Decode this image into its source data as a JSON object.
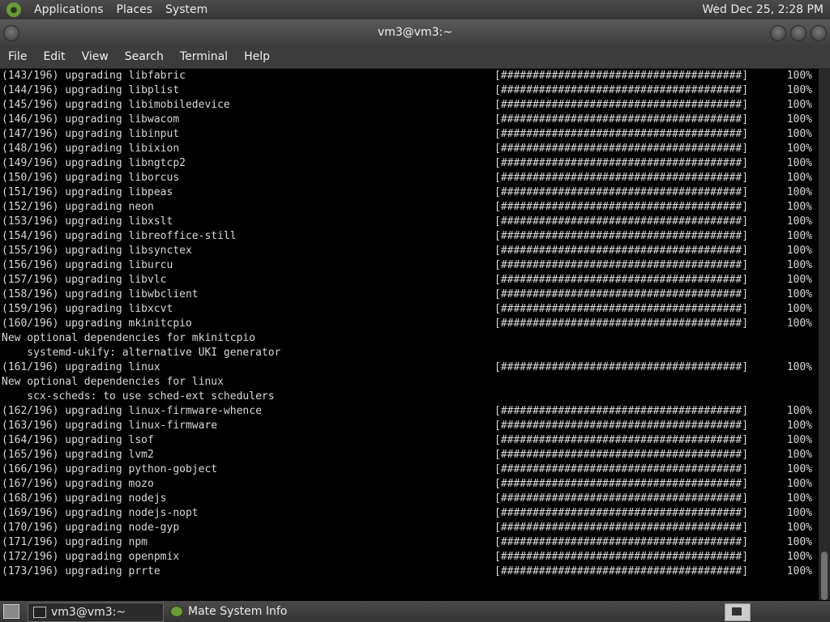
{
  "top_panel": {
    "menu": [
      "Applications",
      "Places",
      "System"
    ],
    "clock": "Wed Dec 25,  2:28 PM"
  },
  "window": {
    "title": "vm3@vm3:~"
  },
  "menubar": [
    "File",
    "Edit",
    "View",
    "Search",
    "Terminal",
    "Help"
  ],
  "terminal": {
    "lines": [
      {
        "text": "(143/196) upgrading libfabric",
        "bar": "[######################################]",
        "pct": "100%"
      },
      {
        "text": "(144/196) upgrading libplist",
        "bar": "[######################################]",
        "pct": "100%"
      },
      {
        "text": "(145/196) upgrading libimobiledevice",
        "bar": "[######################################]",
        "pct": "100%"
      },
      {
        "text": "(146/196) upgrading libwacom",
        "bar": "[######################################]",
        "pct": "100%"
      },
      {
        "text": "(147/196) upgrading libinput",
        "bar": "[######################################]",
        "pct": "100%"
      },
      {
        "text": "(148/196) upgrading libixion",
        "bar": "[######################################]",
        "pct": "100%"
      },
      {
        "text": "(149/196) upgrading libngtcp2",
        "bar": "[######################################]",
        "pct": "100%"
      },
      {
        "text": "(150/196) upgrading liborcus",
        "bar": "[######################################]",
        "pct": "100%"
      },
      {
        "text": "(151/196) upgrading libpeas",
        "bar": "[######################################]",
        "pct": "100%"
      },
      {
        "text": "(152/196) upgrading neon",
        "bar": "[######################################]",
        "pct": "100%"
      },
      {
        "text": "(153/196) upgrading libxslt",
        "bar": "[######################################]",
        "pct": "100%"
      },
      {
        "text": "(154/196) upgrading libreoffice-still",
        "bar": "[######################################]",
        "pct": "100%"
      },
      {
        "text": "(155/196) upgrading libsynctex",
        "bar": "[######################################]",
        "pct": "100%"
      },
      {
        "text": "(156/196) upgrading liburcu",
        "bar": "[######################################]",
        "pct": "100%"
      },
      {
        "text": "(157/196) upgrading libvlc",
        "bar": "[######################################]",
        "pct": "100%"
      },
      {
        "text": "(158/196) upgrading libwbclient",
        "bar": "[######################################]",
        "pct": "100%"
      },
      {
        "text": "(159/196) upgrading libxcvt",
        "bar": "[######################################]",
        "pct": "100%"
      },
      {
        "text": "(160/196) upgrading mkinitcpio",
        "bar": "[######################################]",
        "pct": "100%"
      },
      {
        "text": "New optional dependencies for mkinitcpio",
        "bar": "",
        "pct": ""
      },
      {
        "text": "    systemd-ukify: alternative UKI generator",
        "bar": "",
        "pct": ""
      },
      {
        "text": "(161/196) upgrading linux",
        "bar": "[######################################]",
        "pct": "100%"
      },
      {
        "text": "New optional dependencies for linux",
        "bar": "",
        "pct": ""
      },
      {
        "text": "    scx-scheds: to use sched-ext schedulers",
        "bar": "",
        "pct": ""
      },
      {
        "text": "(162/196) upgrading linux-firmware-whence",
        "bar": "[######################################]",
        "pct": "100%"
      },
      {
        "text": "(163/196) upgrading linux-firmware",
        "bar": "[######################################]",
        "pct": "100%"
      },
      {
        "text": "(164/196) upgrading lsof",
        "bar": "[######################################]",
        "pct": "100%"
      },
      {
        "text": "(165/196) upgrading lvm2",
        "bar": "[######################################]",
        "pct": "100%"
      },
      {
        "text": "(166/196) upgrading python-gobject",
        "bar": "[######################################]",
        "pct": "100%"
      },
      {
        "text": "(167/196) upgrading mozo",
        "bar": "[######################################]",
        "pct": "100%"
      },
      {
        "text": "(168/196) upgrading nodejs",
        "bar": "[######################################]",
        "pct": "100%"
      },
      {
        "text": "(169/196) upgrading nodejs-nopt",
        "bar": "[######################################]",
        "pct": "100%"
      },
      {
        "text": "(170/196) upgrading node-gyp",
        "bar": "[######################################]",
        "pct": "100%"
      },
      {
        "text": "(171/196) upgrading npm",
        "bar": "[######################################]",
        "pct": "100%"
      },
      {
        "text": "(172/196) upgrading openpmix",
        "bar": "[######################################]",
        "pct": "100%"
      },
      {
        "text": "(173/196) upgrading prrte",
        "bar": "[######################################]",
        "pct": "100%"
      }
    ]
  },
  "taskbar": {
    "items": [
      {
        "label": "vm3@vm3:~",
        "icon": "terminal-icon",
        "active": true
      },
      {
        "label": "Mate System Info",
        "icon": "mate-icon",
        "active": false
      }
    ]
  },
  "colors": {
    "terminal_bg": "#000000",
    "terminal_fg": "#d8d8d8",
    "panel": "#3c3c3c"
  }
}
